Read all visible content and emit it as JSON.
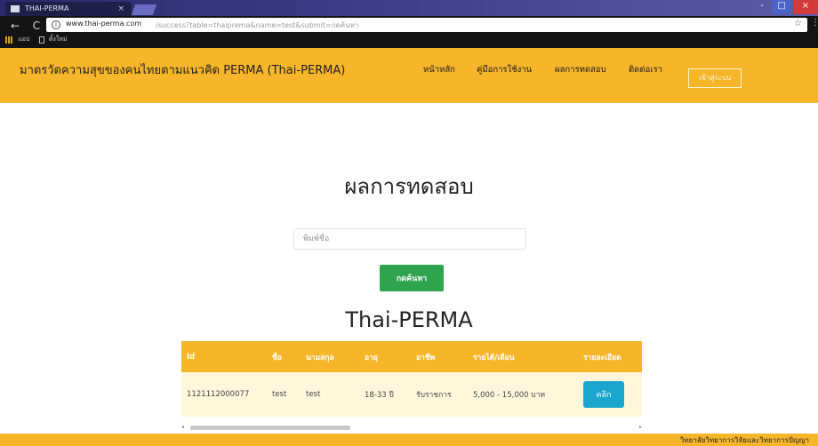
{
  "browser": {
    "tab_title": "THAI-PERMA",
    "tab_close": "×",
    "url_host": "www.thai-perma.com",
    "url_path": "/success?table=thaiprema&name=test&submit=กดค้นหา",
    "bookmarks": [
      "แอป",
      "ตั้งใหม่"
    ],
    "window_controls": [
      "-",
      "□",
      "×"
    ]
  },
  "navbar": {
    "brand": "มาตรวัดความสุขของคนไทยตามแนวคิด PERMA (Thai-PERMA)",
    "links": [
      "หน้าหลัก",
      "คู่มือการใช้งาน",
      "ผลการทดสอบ",
      "ติดต่อเรา"
    ],
    "login_label": "เข้าสู่ระบบ"
  },
  "main": {
    "title": "ผลการทดสอบ",
    "search_placeholder": "พิมพ์ชื่อ",
    "search_button": "กดค้นหา",
    "table_title": "Thai-PERMA"
  },
  "table": {
    "headers": [
      "Id",
      "ชื่อ",
      "นามสกุล",
      "อายุ",
      "อาชีพ",
      "รายได้/เดือน",
      "รายละเอียด"
    ],
    "rows": [
      {
        "id": "1121112000077",
        "first_name": "test",
        "last_name": "test",
        "age": "18-33 ปี",
        "occupation": "รับราชการ",
        "income": "5,000 - 15,000 บาท",
        "detail_button": "คลิก"
      }
    ]
  },
  "footer": {
    "text": "วิทยาลัยวิทยาการวิจัยและวิทยาการปัญญา"
  },
  "colors": {
    "accent": "#f7b52a",
    "button_green": "#2ea44f",
    "button_blue": "#1aa6cf",
    "row_bg": "#fff7dc"
  }
}
